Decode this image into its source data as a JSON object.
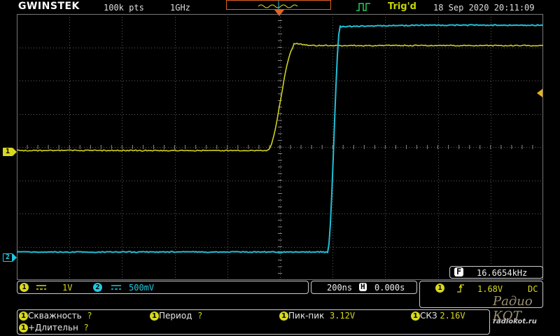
{
  "top": {
    "logo": "GWINSTEK",
    "record_length": "100k pts",
    "sample_rate": "1GHz",
    "trigger_status": "Trig'd",
    "datetime": "18 Sep 2020 20:11:09"
  },
  "markers": {
    "ch1": "1",
    "ch2": "2"
  },
  "frequency": {
    "badge": "F",
    "value": "16.6654kHz"
  },
  "channels": {
    "ch1": {
      "num": "1",
      "coupling_icon": "dc-coupling-icon",
      "scale": "1V"
    },
    "ch2": {
      "num": "2",
      "coupling_icon": "dc-coupling-icon",
      "scale": "500mV"
    }
  },
  "timebase": {
    "scale": "200ns",
    "h_badge": "H",
    "position": "0.000s"
  },
  "trigger": {
    "source": "1",
    "slope_icon": "rising-edge-icon",
    "level": "1.68V",
    "coupling": "DC"
  },
  "measurements": [
    {
      "label": "Скважность",
      "value": "?"
    },
    {
      "label": "Период",
      "value": "?"
    },
    {
      "label": "Пик-пик",
      "value": "3.12V"
    },
    {
      "label": "СКЗ",
      "value": "2.16V"
    },
    {
      "label": "+Длительн",
      "value": "?"
    }
  ],
  "watermark": {
    "line1": "Радио КОТ",
    "line2": "radiokot.ru"
  },
  "colors": {
    "ch1": "#d8d820",
    "ch2": "#20c8e0",
    "grid": "#6a6a6a",
    "memory_bar": "#e06020"
  }
}
